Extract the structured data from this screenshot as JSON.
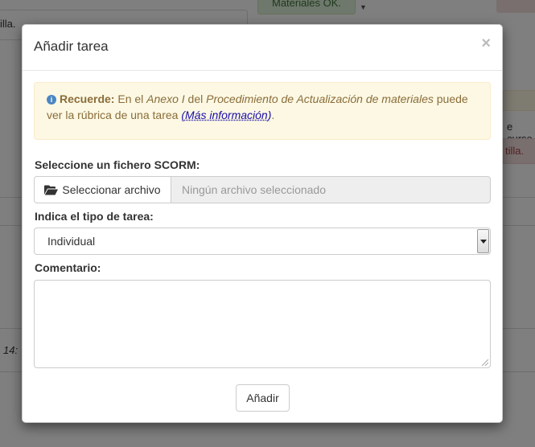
{
  "background": {
    "left_text": "illa.",
    "top_button": "Materiales OK.",
    "right_text_1": "e curso",
    "right_text_2": "tilla.",
    "time_text": "14:"
  },
  "modal": {
    "title": "Añadir tarea",
    "close_symbol": "×",
    "alert": {
      "icon": "info-icon",
      "strong": "Recuerde:",
      "text_1": " En el ",
      "italic_1": "Anexo I",
      "text_2": " del ",
      "italic_2": "Procedimiento de Actualización de materiales",
      "text_3": " puede ver la rúbrica de una tarea ",
      "link": "(Más información)",
      "text_4": "."
    },
    "file": {
      "label": "Seleccione un fichero SCORM:",
      "button_label": "Seleccionar archivo",
      "placeholder": "Ningún archivo seleccionado"
    },
    "task_type": {
      "label": "Indica el tipo de tarea:",
      "selected": "Individual"
    },
    "comment": {
      "label": "Comentario:",
      "value": ""
    },
    "submit_label": "Añadir"
  }
}
